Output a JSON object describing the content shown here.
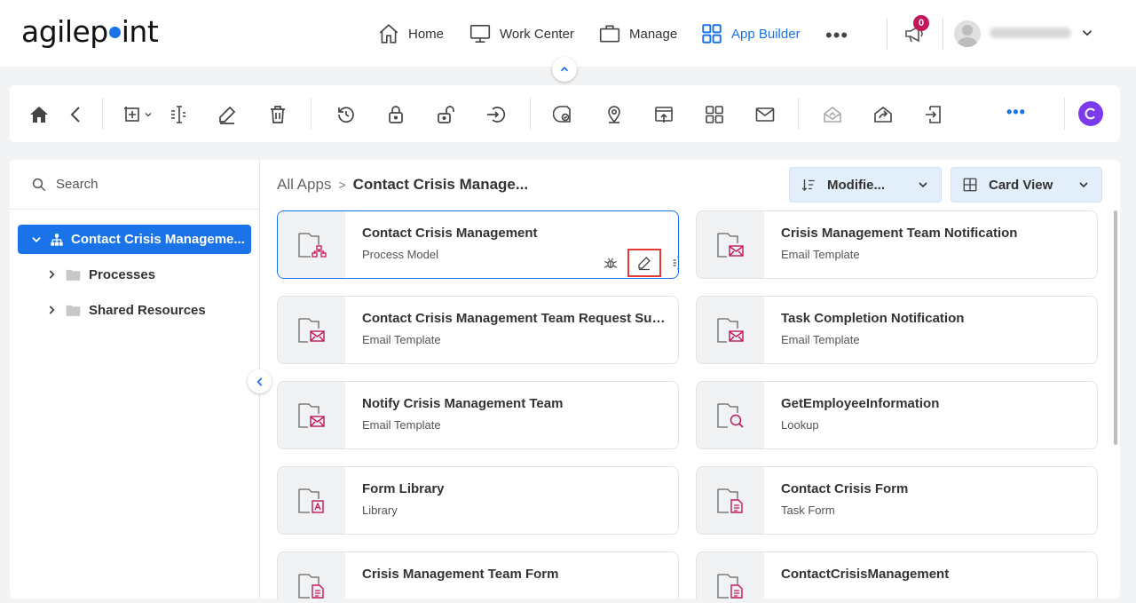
{
  "brand": {
    "logo_before": "agilep",
    "logo_after": "int"
  },
  "nav": {
    "home": "Home",
    "work_center": "Work Center",
    "manage": "Manage",
    "app_builder": "App Builder",
    "notifications_count": "0"
  },
  "sidebar": {
    "search_placeholder": "Search",
    "root_label": "Contact Crisis Manageme...",
    "items": [
      {
        "label": "Processes"
      },
      {
        "label": "Shared Resources"
      }
    ]
  },
  "main": {
    "breadcrumb": {
      "root": "All Apps",
      "separator": ">",
      "current": "Contact Crisis Manage..."
    },
    "sort_label": "Modifie...",
    "view_label": "Card View",
    "cards": [
      {
        "title": "Contact Crisis Management",
        "subtitle": "Process Model",
        "icon": "process-model-icon",
        "selected": true
      },
      {
        "title": "Crisis Management Team Notification",
        "subtitle": "Email Template",
        "icon": "email-template-icon"
      },
      {
        "title": "Contact Crisis Management Team Request Submi...",
        "subtitle": "Email Template",
        "icon": "email-template-icon"
      },
      {
        "title": "Task Completion Notification",
        "subtitle": "Email Template",
        "icon": "email-template-icon"
      },
      {
        "title": "Notify Crisis Management Team",
        "subtitle": "Email Template",
        "icon": "email-template-icon"
      },
      {
        "title": "GetEmployeeInformation",
        "subtitle": "Lookup",
        "icon": "lookup-icon"
      },
      {
        "title": "Form Library",
        "subtitle": "Library",
        "icon": "library-icon"
      },
      {
        "title": "Contact Crisis Form",
        "subtitle": "Task Form",
        "icon": "task-form-icon"
      },
      {
        "title": "Crisis Management Team Form",
        "subtitle": "",
        "icon": "task-form-icon"
      },
      {
        "title": "ContactCrisisManagement",
        "subtitle": "",
        "icon": "task-form-icon"
      }
    ]
  },
  "colors": {
    "accent": "#1a73e8",
    "magenta": "#c2185b",
    "highlight": "#e53935",
    "avatar_c": "#7c3aed"
  }
}
